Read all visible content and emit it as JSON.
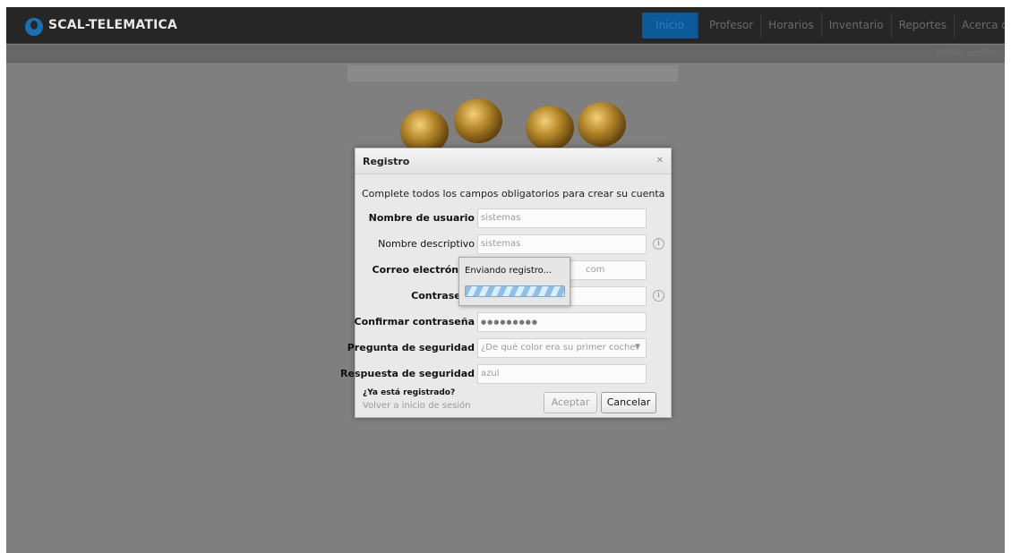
{
  "app": {
    "brand": "SCAL-TELEMATICA"
  },
  "nav": {
    "items": [
      {
        "label": "Inicio",
        "active": true
      },
      {
        "label": "Profesor"
      },
      {
        "label": "Horarios"
      },
      {
        "label": "Inventario"
      },
      {
        "label": "Reportes"
      },
      {
        "label": "Acerca de"
      }
    ]
  },
  "subbar": {
    "logout": "Iniciar sesión"
  },
  "dialog": {
    "title": "Registro",
    "close_icon": "close-icon",
    "intro": "Complete todos los campos obligatorios para crear su cuenta",
    "fields": [
      {
        "label": "Nombre de usuario",
        "value": "sistemas"
      },
      {
        "label": "Nombre descriptivo",
        "value": "sistemas",
        "info": "i"
      },
      {
        "label": "Correo electrónico",
        "value": "com"
      },
      {
        "label": "Contraseña",
        "value": "",
        "info": "i"
      },
      {
        "label": "Confirmar contraseña",
        "value": "●●●●●●●●●"
      },
      {
        "label": "Pregunta de seguridad",
        "value": "¿De qué color era su primer coche?",
        "arrow": "▼"
      },
      {
        "label": "Respuesta de seguridad",
        "value": "azul"
      }
    ],
    "registered_question": "¿Ya está registrado?",
    "back_link": "Volver a inicio de sesión",
    "accept_label": "Aceptar",
    "cancel_label": "Cancelar"
  },
  "loading": {
    "text": "Enviando registro..."
  },
  "colors": {
    "accent": "#0c5a9a",
    "navbar": "#262626",
    "overlay": "#7f7f7f"
  }
}
